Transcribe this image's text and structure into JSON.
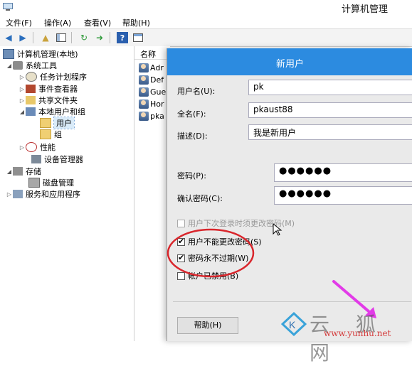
{
  "window": {
    "title": "计算机管理"
  },
  "menu": [
    "文件(F)",
    "操作(A)",
    "查看(V)",
    "帮助(H)"
  ],
  "toolbar": [
    "back-icon",
    "forward-icon",
    "up-folder-icon",
    "show-hide-tree-icon",
    "refresh-icon",
    "export-icon",
    "help-icon",
    "view-icon"
  ],
  "tree": {
    "root": "计算机管理(本地)",
    "system_tools": "系统工具",
    "task_scheduler": "任务计划程序",
    "event_viewer": "事件查看器",
    "shared_folders": "共享文件夹",
    "local_users": "本地用户和组",
    "users": "用户",
    "groups": "组",
    "performance": "性能",
    "device_manager": "设备管理器",
    "storage": "存储",
    "disk_mgmt": "磁盘管理",
    "services": "服务和应用程序"
  },
  "list": {
    "header": "名称",
    "rows": [
      "Adr",
      "Def",
      "Gue",
      "Hor",
      "pka"
    ]
  },
  "dialog": {
    "title": "新用户",
    "username_label": "用户名(U):",
    "username_value": "pk",
    "fullname_label": "全名(F):",
    "fullname_value": "pkaust88",
    "desc_label": "描述(D):",
    "desc_value": "我是新用户",
    "password_label": "密码(P):",
    "password_value": "●●●●●●",
    "confirm_label": "确认密码(C):",
    "confirm_value": "●●●●●●",
    "must_change": {
      "label": "用户下次登录时须更改密码(M)",
      "checked": false,
      "disabled": true
    },
    "cannot_change": {
      "label": "用户不能更改密码(S)",
      "checked": true
    },
    "never_expires": {
      "label": "密码永不过期(W)",
      "checked": true
    },
    "disabled_acct": {
      "label": "帐户已禁用(B)",
      "checked": false
    },
    "help_button": "帮助(H)"
  },
  "watermark": {
    "chars": "云 狐 网",
    "url": "www.yunhu.net"
  },
  "colors": {
    "dialog_title_bg": "#2c8be0",
    "annotation_red": "#d9262c",
    "arrow_magenta": "#e23be8"
  }
}
